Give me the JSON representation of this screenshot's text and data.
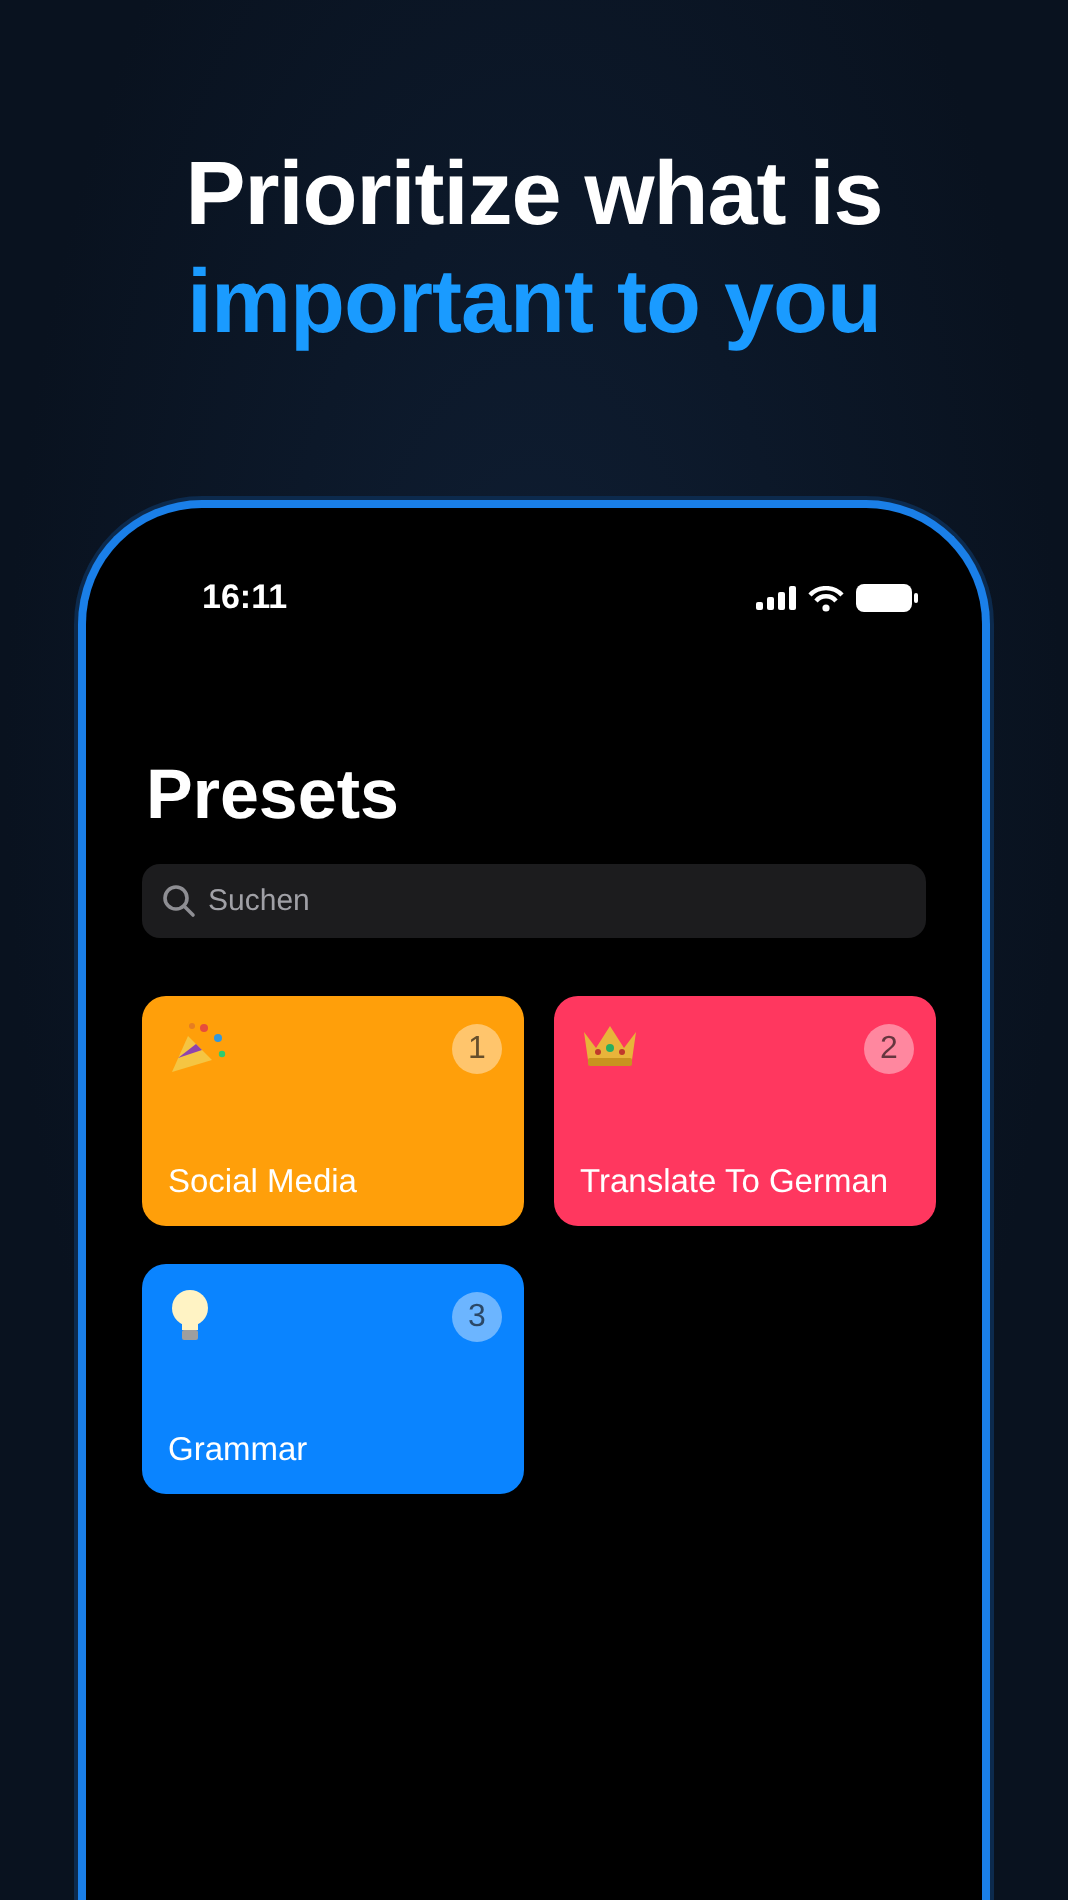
{
  "headline": {
    "line_1": "Prioritize what is",
    "line_2": "important to you"
  },
  "status_bar": {
    "time": "16:11"
  },
  "screen": {
    "title": "Presets",
    "search": {
      "placeholder": "Suchen"
    },
    "presets": [
      {
        "kind": "party",
        "label": "Social Media",
        "number": "1",
        "color": "#ff9f0a"
      },
      {
        "kind": "crown",
        "label": "Translate To German",
        "number": "2",
        "color": "#ff375f"
      },
      {
        "kind": "bulb",
        "label": "Grammar",
        "number": "3",
        "color": "#0a84ff"
      }
    ]
  }
}
